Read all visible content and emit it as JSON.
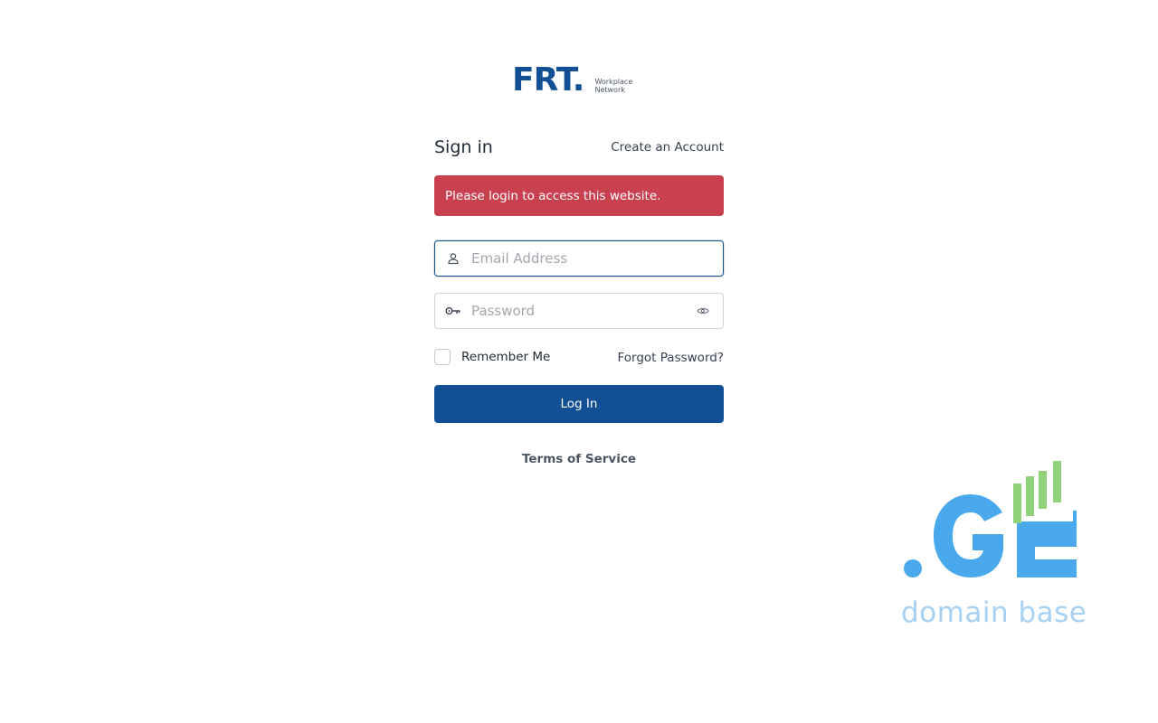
{
  "brand": {
    "mark": "FRT.",
    "tagline_line1": "Workplace",
    "tagline_line2": "Network",
    "color": "#124f94"
  },
  "header": {
    "title": "Sign in",
    "create_account": "Create an Account"
  },
  "alert": {
    "message": "Please login to access this website.",
    "color": "#c9404f"
  },
  "email": {
    "placeholder": "Email Address",
    "value": "",
    "icon": "user-icon"
  },
  "password": {
    "placeholder": "Password",
    "value": "",
    "icon": "key-icon",
    "toggle_icon": "eye-icon"
  },
  "options": {
    "remember_label": "Remember Me",
    "remember_checked": false,
    "forgot_label": "Forgot Password?"
  },
  "actions": {
    "login_label": "Log In",
    "login_color": "#124f94"
  },
  "footer": {
    "terms_label": "Terms of Service"
  },
  "watermark": {
    "caption": "domain base",
    "logo_text": ".GE",
    "blue": "#4aa8ec",
    "green": "#8fd27a"
  }
}
